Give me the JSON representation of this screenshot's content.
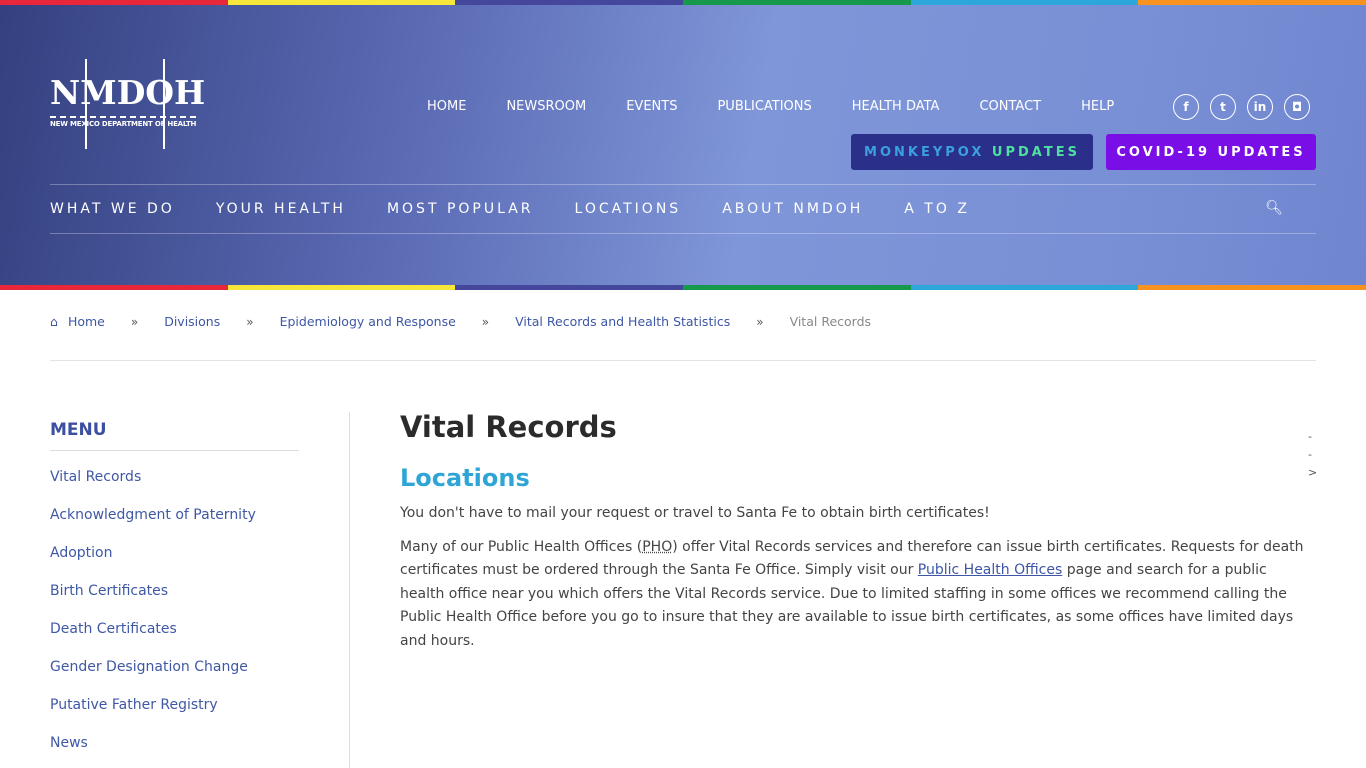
{
  "colors": {
    "rainbow": [
      "#e8273a",
      "#f7e73a",
      "#45479c",
      "#17994b",
      "#2ba7dc",
      "#f7931e"
    ],
    "monkeypox_blue": "#3aa0e0",
    "monkeypox_green": "#4fe0a0",
    "covid_bg": "#7a0ee6"
  },
  "logo": {
    "title": "NMDOH",
    "subtitle": "NEW MEXICO DEPARTMENT OF HEALTH"
  },
  "topnav": [
    "HOME",
    "NEWSROOM",
    "EVENTS",
    "PUBLICATIONS",
    "HEALTH DATA",
    "CONTACT",
    "HELP"
  ],
  "social": [
    {
      "icon": "facebook-icon",
      "glyph": "f"
    },
    {
      "icon": "twitter-icon",
      "glyph": "t"
    },
    {
      "icon": "linkedin-icon",
      "glyph": "in"
    },
    {
      "icon": "instagram-icon",
      "glyph": "◘"
    }
  ],
  "buttons": {
    "monkeypox_a": "MONKEYPOX",
    "monkeypox_b": "UPDATES",
    "covid": "COVID-19 UPDATES"
  },
  "mainnav": [
    "WHAT WE DO",
    "YOUR HEALTH",
    "MOST POPULAR",
    "LOCATIONS",
    "ABOUT NMDOH",
    "A TO Z"
  ],
  "breadcrumb": [
    "Home",
    "Divisions",
    "Epidemiology and Response",
    "Vital Records and Health Statistics",
    "Vital Records"
  ],
  "sidebar": {
    "title": "MENU",
    "items": [
      "Vital Records",
      "Acknowledgment of Paternity",
      "Adoption",
      "Birth Certificates",
      "Death Certificates",
      "Gender Designation Change",
      "Putative Father Registry",
      "News"
    ]
  },
  "content": {
    "title": "Vital Records",
    "subtitle": "Locations",
    "p1": "You don't have to mail your request or travel to Santa Fe to obtain birth certificates!",
    "p2a": "Many of our Public Health Offices (",
    "abbr": "PHO",
    "p2b": ") offer Vital Records services and therefore can issue birth certificates. Requests for death certificates must be ordered through the Santa Fe Office. Simply visit our ",
    "link": "Public Health Offices",
    "p2c": " page and search for a public health office near you which offers the Vital Records service. Due to limited staffing in some offices we recommend calling the Public Health Office before you go to insure that they are available to issue birth certificates, as some offices have limited days and hours."
  },
  "side_marks": [
    "-",
    "-",
    ">"
  ]
}
